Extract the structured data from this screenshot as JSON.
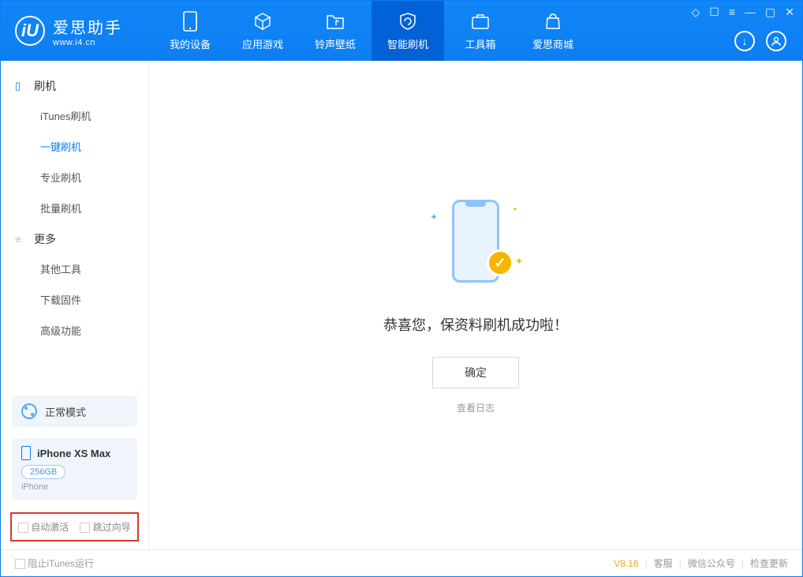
{
  "header": {
    "app_name_cn": "爱思助手",
    "app_name_en": "www.i4.cn",
    "tabs": {
      "device": "我的设备",
      "apps": "应用游戏",
      "ring": "铃声壁纸",
      "flash": "智能刷机",
      "tools": "工具箱",
      "store": "爱思商城"
    }
  },
  "sidebar": {
    "sect_flash": "刷机",
    "items_flash": {
      "itunes": "iTunes刷机",
      "onekey": "一键刷机",
      "pro": "专业刷机",
      "batch": "批量刷机"
    },
    "sect_more": "更多",
    "items_more": {
      "other": "其他工具",
      "firmware": "下载固件",
      "advanced": "高级功能"
    },
    "mode_label": "正常模式",
    "device_name": "iPhone XS Max",
    "device_storage": "256GB",
    "device_type": "iPhone",
    "opt_auto_activate": "自动激活",
    "opt_skip_guide": "跳过向导"
  },
  "main": {
    "success_text": "恭喜您，保资料刷机成功啦！",
    "ok_button": "确定",
    "view_log": "查看日志"
  },
  "footer": {
    "block_itunes": "阻止iTunes运行",
    "version": "V8.16",
    "support": "客服",
    "wechat": "微信公众号",
    "update": "检查更新"
  }
}
